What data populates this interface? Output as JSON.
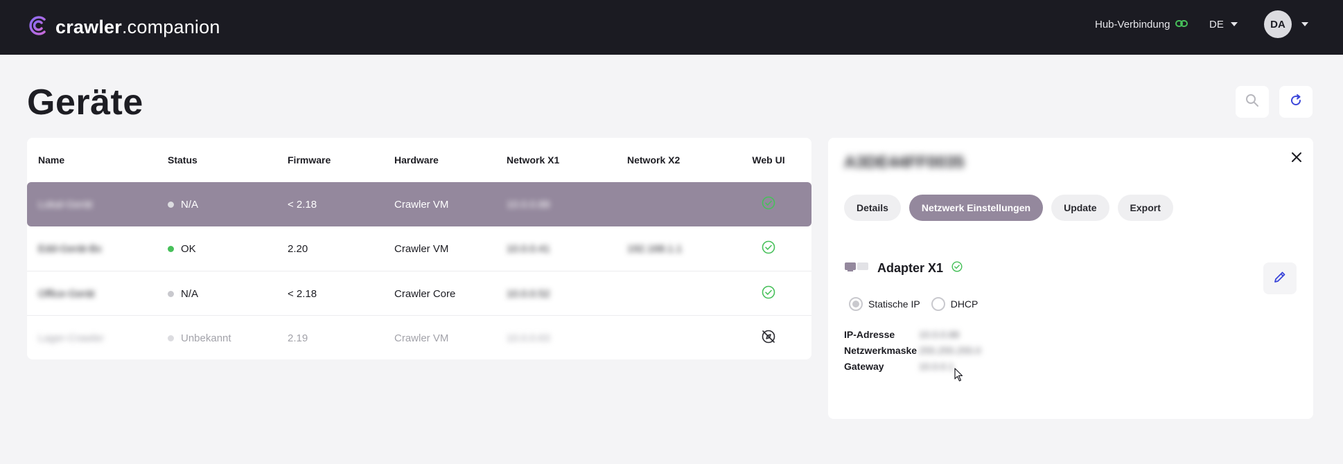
{
  "app": {
    "logo_bold": "crawler",
    "logo_rest": ".companion"
  },
  "topbar": {
    "hub_label": "Hub-Verbindung",
    "language": "DE",
    "user_initials": "DA"
  },
  "page": {
    "title": "Geräte"
  },
  "table": {
    "headers": [
      "Name",
      "Status",
      "Firmware",
      "Hardware",
      "Network X1",
      "Network X2",
      "Web UI"
    ],
    "rows": [
      {
        "name": "Lokal-Gerät",
        "status": "N/A",
        "firmware": "< 2.18",
        "hardware": "Crawler VM",
        "x1": "10.0.0.88",
        "x2": "",
        "web": "ok",
        "selected": true
      },
      {
        "name": "Edd-Gerät-Bx",
        "status": "OK",
        "firmware": "2.20",
        "hardware": "Crawler VM",
        "x1": "10.0.0.41",
        "x2": "192.168.1.1",
        "web": "ok"
      },
      {
        "name": "Office-Gerät",
        "status": "N/A",
        "firmware": "< 2.18",
        "hardware": "Crawler Core",
        "x1": "10.0.0.52",
        "x2": "",
        "web": "ok"
      },
      {
        "name": "Lager-Crawler",
        "status": "Unbekannt",
        "firmware": "2.19",
        "hardware": "Crawler VM",
        "x1": "10.0.0.63",
        "x2": "",
        "web": "offline",
        "muted": true
      }
    ]
  },
  "detail": {
    "title": "A3DE44FF0035",
    "tabs": [
      "Details",
      "Netzwerk Einstellungen",
      "Update",
      "Export"
    ],
    "active_tab": "Netzwerk Einstellungen",
    "adapter_title": "Adapter X1",
    "radio_static": "Statische IP",
    "radio_dhcp": "DHCP",
    "fields": [
      {
        "label": "IP-Adresse",
        "value": "10.0.0.88"
      },
      {
        "label": "Netzwerkmaske",
        "value": "255.255.255.0"
      },
      {
        "label": "Gateway",
        "value": "10.0.0.1"
      }
    ]
  },
  "colors": {
    "accent": "#94889d",
    "ok_green": "#47c05a",
    "na_grey": "#c9c9ce",
    "topbar": "#1b1b22"
  }
}
